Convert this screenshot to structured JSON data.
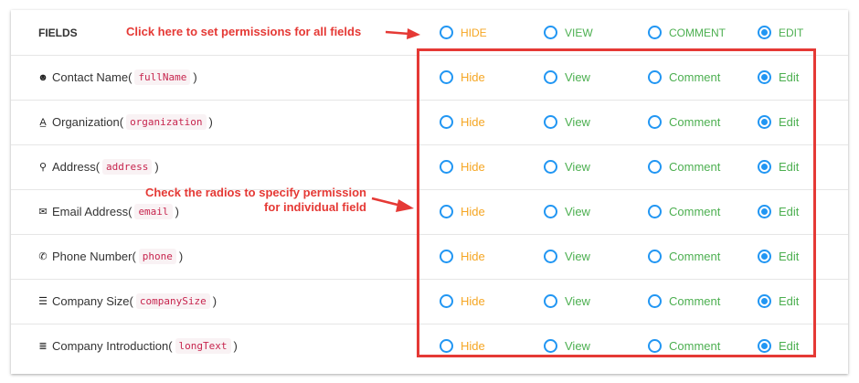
{
  "header": {
    "title": "FIELDS",
    "options": {
      "hide": "HIDE",
      "view": "VIEW",
      "comment": "COMMENT",
      "edit": "EDIT"
    },
    "selected": "edit"
  },
  "option_labels": {
    "hide": "Hide",
    "view": "View",
    "comment": "Comment",
    "edit": "Edit"
  },
  "fields": [
    {
      "label": "Contact Name",
      "key": "fullName",
      "icon": "user-icon",
      "selected": "edit"
    },
    {
      "label": "Organization",
      "key": "organization",
      "icon": "font-icon",
      "selected": "edit"
    },
    {
      "label": "Address",
      "key": "address",
      "icon": "map-marker-icon",
      "selected": "edit"
    },
    {
      "label": "Email Address",
      "key": "email",
      "icon": "envelope-icon",
      "selected": "edit"
    },
    {
      "label": "Phone Number",
      "key": "phone",
      "icon": "phone-icon",
      "selected": "edit"
    },
    {
      "label": "Company Size",
      "key": "companySize",
      "icon": "list-icon",
      "selected": "edit"
    },
    {
      "label": "Company Introduction",
      "key": "longText",
      "icon": "align-justify-icon",
      "selected": "edit"
    }
  ],
  "annotations": {
    "all_fields": "Click here to set permissions for all fields",
    "individual_line1": "Check the radios to specify permission",
    "individual_line2": "for individual field"
  },
  "colors": {
    "hide": "#f5a623",
    "view": "#4caf50",
    "comment": "#4caf50",
    "edit": "#4caf50",
    "radio": "#2196f3",
    "annotation": "#e53935"
  }
}
